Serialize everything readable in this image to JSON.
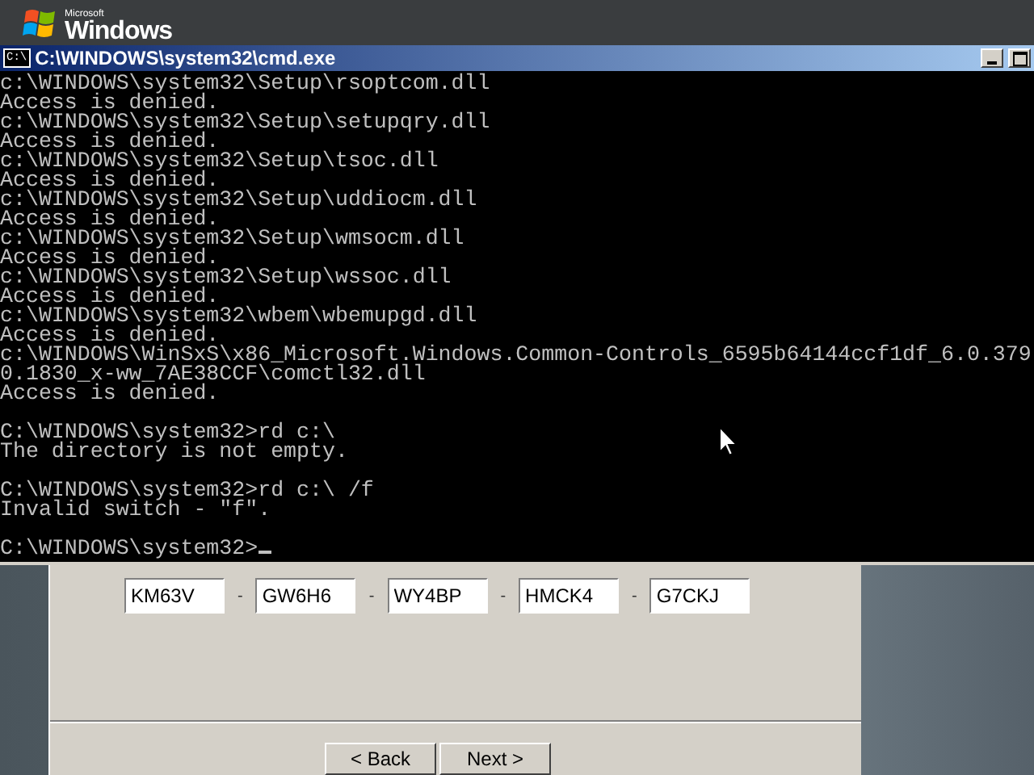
{
  "desktop": {
    "logo": {
      "brand": "Microsoft",
      "name": "Windows"
    }
  },
  "console_window": {
    "title": "C:\\WINDOWS\\system32\\cmd.exe",
    "icon_text": "C:\\",
    "lines": [
      {
        "kind": "text",
        "text": "c:\\WINDOWS\\system32\\Setup\\rsoptcom.dll"
      },
      {
        "kind": "text",
        "text": "Access is denied."
      },
      {
        "kind": "text",
        "text": "c:\\WINDOWS\\system32\\Setup\\setupqry.dll"
      },
      {
        "kind": "text",
        "text": "Access is denied."
      },
      {
        "kind": "text",
        "text": "c:\\WINDOWS\\system32\\Setup\\tsoc.dll"
      },
      {
        "kind": "text",
        "text": "Access is denied."
      },
      {
        "kind": "text",
        "text": "c:\\WINDOWS\\system32\\Setup\\uddiocm.dll"
      },
      {
        "kind": "text",
        "text": "Access is denied."
      },
      {
        "kind": "text",
        "text": "c:\\WINDOWS\\system32\\Setup\\wmsocm.dll"
      },
      {
        "kind": "text",
        "text": "Access is denied."
      },
      {
        "kind": "text",
        "text": "c:\\WINDOWS\\system32\\Setup\\wssoc.dll"
      },
      {
        "kind": "text",
        "text": "Access is denied."
      },
      {
        "kind": "text",
        "text": "c:\\WINDOWS\\system32\\wbem\\wbemupgd.dll"
      },
      {
        "kind": "text",
        "text": "Access is denied."
      },
      {
        "kind": "text",
        "text": "c:\\WINDOWS\\WinSxS\\x86_Microsoft.Windows.Common-Controls_6595b64144ccf1df_6.0.379"
      },
      {
        "kind": "text",
        "text": "0.1830_x-ww_7AE38CCF\\comctl32.dll"
      },
      {
        "kind": "text",
        "text": "Access is denied."
      },
      {
        "kind": "blank"
      },
      {
        "kind": "text",
        "text": "C:\\WINDOWS\\system32>rd c:\\"
      },
      {
        "kind": "text",
        "text": "The directory is not empty."
      },
      {
        "kind": "blank"
      },
      {
        "kind": "text",
        "text": "C:\\WINDOWS\\system32>rd c:\\ /f"
      },
      {
        "kind": "text",
        "text": "Invalid switch - \"f\"."
      },
      {
        "kind": "blank"
      },
      {
        "kind": "prompt",
        "text": "C:\\WINDOWS\\system32>"
      }
    ]
  },
  "wizard": {
    "product_key": [
      "KM63V",
      "GW6H6",
      "WY4BP",
      "HMCK4",
      "G7CKJ"
    ],
    "separator": "-",
    "buttons": [
      {
        "label": "< Back"
      },
      {
        "label": "Next >"
      }
    ]
  }
}
